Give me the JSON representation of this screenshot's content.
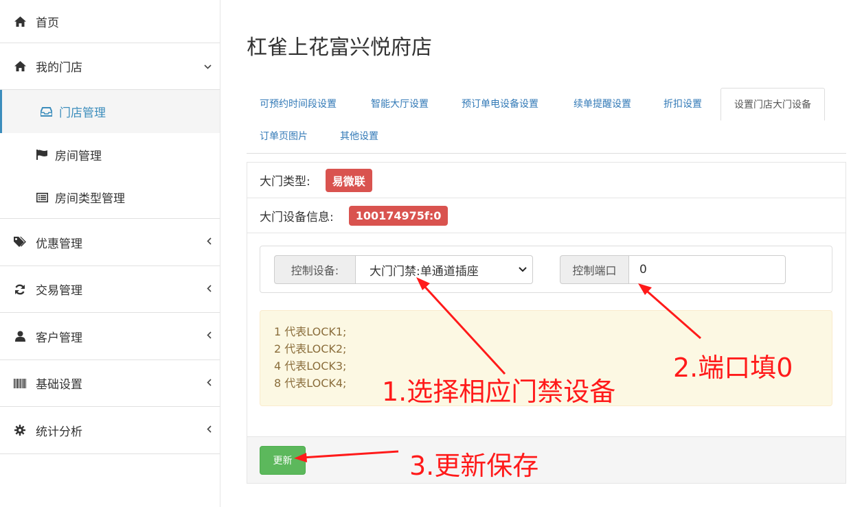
{
  "sidebar": {
    "items": [
      {
        "label": "首页",
        "icon": "home-icon"
      },
      {
        "label": "我的门店",
        "icon": "home-icon"
      },
      {
        "label": "门店管理",
        "icon": "inbox-icon"
      },
      {
        "label": "房间管理",
        "icon": "flag-icon"
      },
      {
        "label": "房间类型管理",
        "icon": "list-icon"
      },
      {
        "label": "优惠管理",
        "icon": "tags-icon"
      },
      {
        "label": "交易管理",
        "icon": "refresh-icon"
      },
      {
        "label": "客户管理",
        "icon": "user-icon"
      },
      {
        "label": "基础设置",
        "icon": "barcode-icon"
      },
      {
        "label": "统计分析",
        "icon": "cog-icon"
      }
    ],
    "active_color": "#3c8dbc"
  },
  "page": {
    "title": "杠雀上花富兴悦府店"
  },
  "tabs": [
    "可预约时间段设置",
    "智能大厅设置",
    "预订单电设备设置",
    "续单提醒设置",
    "折扣设置",
    "设置门店大门设备",
    "订单页图片",
    "其他设置"
  ],
  "door": {
    "type_label": "大门类型:",
    "type_value": "易微联",
    "info_label": "大门设备信息:",
    "info_value": "100174975f:0",
    "badge_color": "#d9534f"
  },
  "control": {
    "device_label": "控制设备:",
    "device_value": "大门门禁:单通道插座",
    "port_label": "控制端口",
    "port_value": "0"
  },
  "note": {
    "lines": [
      "1 代表LOCK1;",
      "2 代表LOCK2;",
      "4 代表LOCK3;",
      "8 代表LOCK4;"
    ]
  },
  "footer": {
    "update_label": "更新",
    "button_color": "#5cb85c"
  },
  "annotations": {
    "step1": "1.选择相应门禁设备",
    "step2": "2.端口填0",
    "step3": "3.更新保存",
    "color": "#ff1a1a"
  }
}
